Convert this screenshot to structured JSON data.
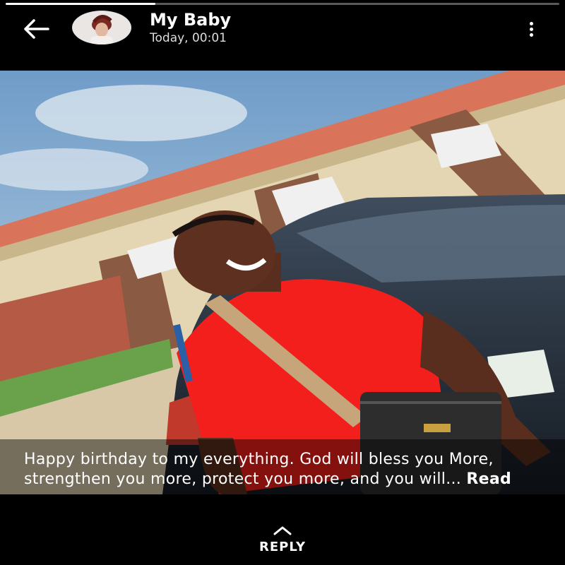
{
  "status": {
    "progress": 0.27
  },
  "header": {
    "title": "My Baby",
    "timestamp": "Today, 00:01",
    "back_icon": "arrow-left-icon",
    "menu_icon": "more-vertical-icon"
  },
  "post": {
    "caption": "Happy birthday to my everything. God will bless you More, strengthen you more, protect you more, and you will...",
    "read_more_label": "Read"
  },
  "footer": {
    "reply_label": "REPLY",
    "reply_icon": "chevron-up-icon"
  },
  "colors": {
    "background": "#000000",
    "shirt": "#f21f1c",
    "roof": "#d9735a",
    "sky": "#7fa9d0"
  }
}
